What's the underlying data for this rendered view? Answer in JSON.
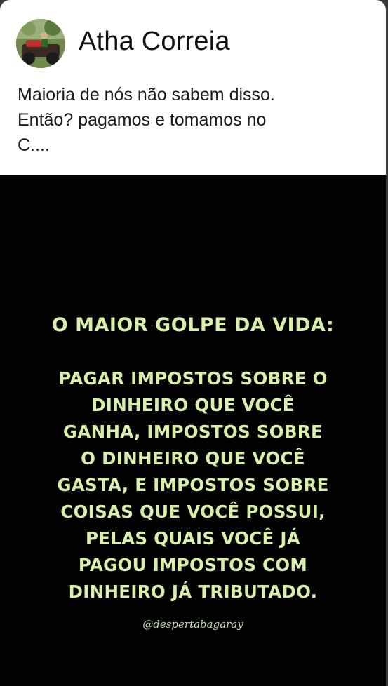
{
  "post": {
    "author": "Atha Correia",
    "avatar_icon": "profile-photo-icon",
    "text_lines": [
      "Maioria de nós não sabem disso.",
      "Então?  pagamos e tomamos no",
      "C...."
    ]
  },
  "meme": {
    "title": "O MAIOR GOLPE DA VIDA:",
    "body_lines": [
      "PAGAR IMPOSTOS SOBRE O",
      "DINHEIRO QUE VOCÊ",
      "GANHA, IMPOSTOS SOBRE",
      "O DINHEIRO QUE VOCÊ",
      "GASTA, E IMPOSTOS SOBRE",
      "COISAS QUE VOCÊ POSSUI,",
      "PELAS QUAIS VOCÊ JÁ",
      "PAGOU IMPOSTOS COM",
      "DINHEIRO JÁ TRIBUTADO."
    ],
    "watermark": "@despertabagaray",
    "text_color": "#d8f0a8",
    "background_color": "#020202"
  }
}
